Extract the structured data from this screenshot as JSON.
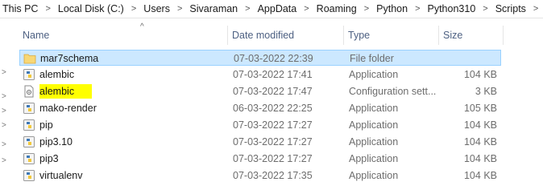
{
  "breadcrumb": [
    "This PC",
    "Local Disk (C:)",
    "Users",
    "Sivaraman",
    "AppData",
    "Roaming",
    "Python",
    "Python310",
    "Scripts"
  ],
  "columns": {
    "name": "Name",
    "date": "Date modified",
    "type": "Type",
    "size": "Size"
  },
  "files": [
    {
      "name": "mar7schema",
      "date": "07-03-2022 22:39",
      "type": "File folder",
      "size": "",
      "icon": "folder-icon",
      "selected": true
    },
    {
      "name": "alembic",
      "date": "07-03-2022 17:41",
      "type": "Application",
      "size": "104 KB",
      "icon": "python-app-icon"
    },
    {
      "name": "alembic",
      "date": "07-03-2022 17:47",
      "type": "Configuration sett...",
      "size": "3 KB",
      "icon": "config-file-icon",
      "highlighted": true
    },
    {
      "name": "mako-render",
      "date": "06-03-2022 22:25",
      "type": "Application",
      "size": "105 KB",
      "icon": "python-app-icon"
    },
    {
      "name": "pip",
      "date": "07-03-2022 17:27",
      "type": "Application",
      "size": "104 KB",
      "icon": "python-app-icon"
    },
    {
      "name": "pip3.10",
      "date": "07-03-2022 17:27",
      "type": "Application",
      "size": "104 KB",
      "icon": "python-app-icon"
    },
    {
      "name": "pip3",
      "date": "07-03-2022 17:27",
      "type": "Application",
      "size": "104 KB",
      "icon": "python-app-icon"
    },
    {
      "name": "virtualenv",
      "date": "07-03-2022 17:35",
      "type": "Application",
      "size": "104 KB",
      "icon": "python-app-icon"
    }
  ],
  "colors": {
    "selection": "#cce8ff",
    "highlight": "#ffff00",
    "header_text": "#4d6082"
  }
}
